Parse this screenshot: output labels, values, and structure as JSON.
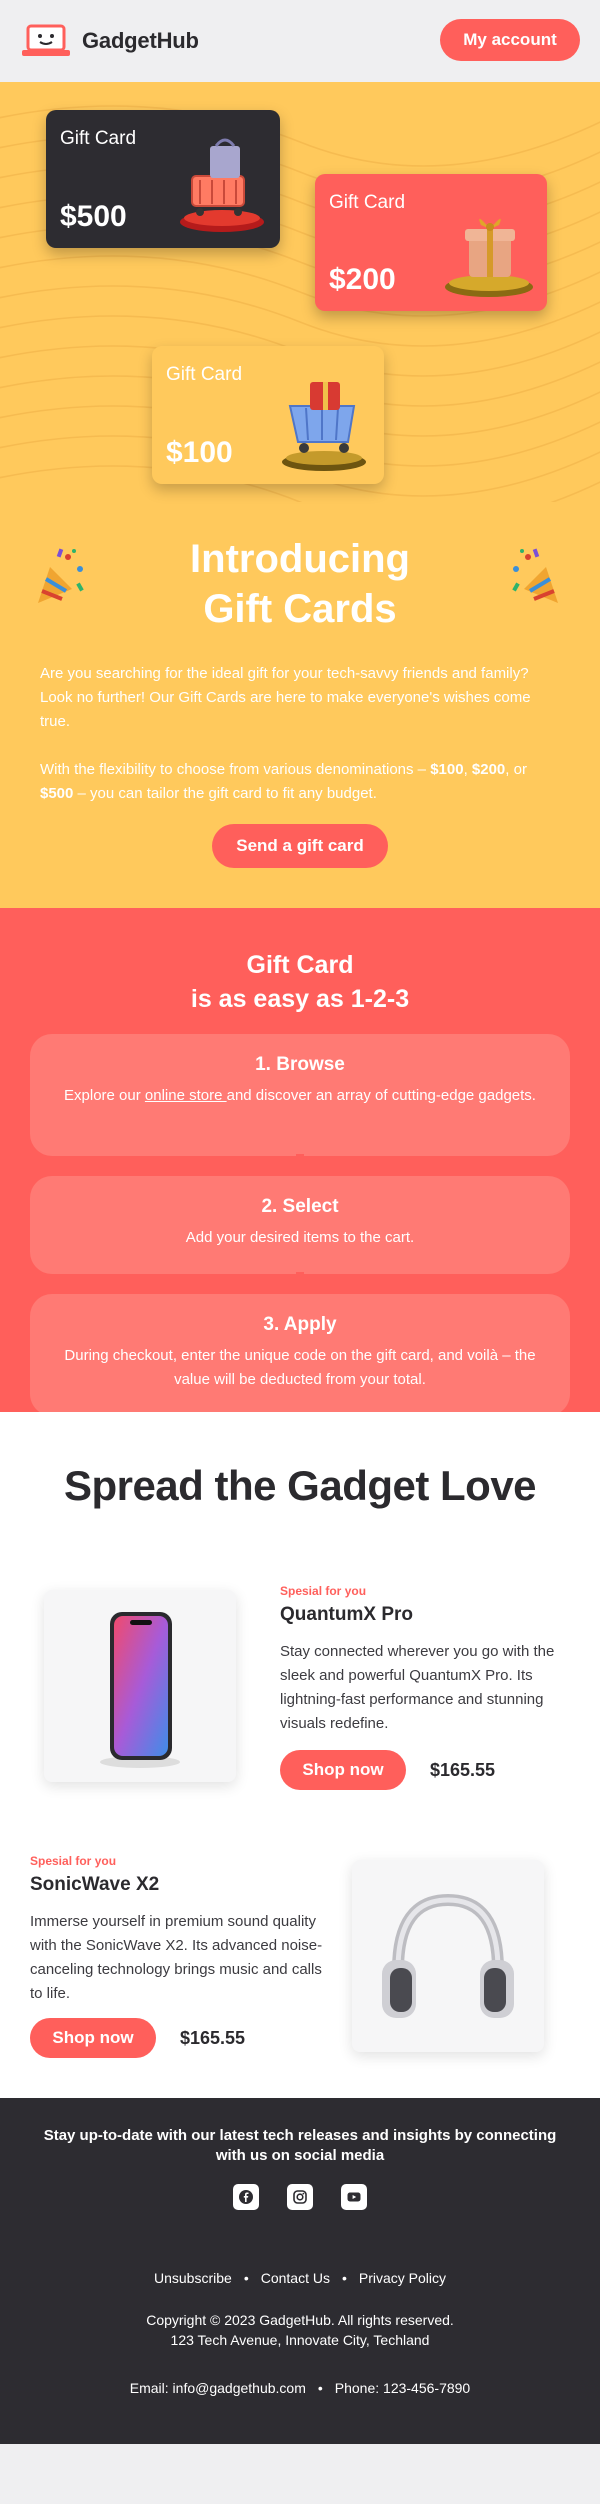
{
  "header": {
    "brand": "GadgetHub",
    "account_label": "My account"
  },
  "hero": {
    "cards": [
      {
        "title": "Gift Card",
        "amount": "$500"
      },
      {
        "title": "Gift Card",
        "amount": "$200"
      },
      {
        "title": "Gift Card",
        "amount": "$100"
      }
    ],
    "title_line1": "Introducing",
    "title_line2": "Gift Cards",
    "paragraph1": "Are you searching for the ideal gift for your tech-savvy friends and family? Look no further! Our Gift Cards are here to make everyone's wishes come true.",
    "paragraph2_prefix": "With the flexibility to choose from various denominations – ",
    "denom1": "$100",
    "denom2": "$200",
    "denom3": "$500",
    "paragraph2_suffix": " – you can tailor the gift card to fit any budget.",
    "cta_label": "Send a gift card"
  },
  "steps": {
    "title_line1": "Gift Card",
    "title_line2": "is as easy as 1-2-3",
    "items": [
      {
        "heading": "1. Browse",
        "before_link": "Explore our ",
        "link": "online store ",
        "after_link": "and discover an array of cutting-edge gadgets."
      },
      {
        "heading": "2. Select",
        "text": "Add your desired items to the cart."
      },
      {
        "heading": "3. Apply",
        "text": "During checkout, enter the unique code on the gift card, and voilà – the value will be deducted from your total."
      }
    ]
  },
  "products": {
    "title": "Spread the Gadget Love",
    "items": [
      {
        "tag": "Spesial for you",
        "name": "QuantumX Pro",
        "description": "Stay connected wherever you go with the sleek and powerful QuantumX Pro. Its lightning-fast performance and stunning visuals redefine.",
        "button": "Shop now",
        "price": "$165.55",
        "image_icon": "smartphone-icon"
      },
      {
        "tag": "Spesial for you",
        "name": "SonicWave X2",
        "description": "Immerse yourself in premium sound quality with the SonicWave X2. Its advanced noise-canceling technology brings music and calls to life.",
        "button": "Shop now",
        "price": "$165.55",
        "image_icon": "headphones-icon"
      }
    ]
  },
  "footer": {
    "headline": "Stay up-to-date with our latest tech releases and insights by connecting with us on social media",
    "social": [
      "facebook-icon",
      "instagram-icon",
      "youtube-icon"
    ],
    "links": [
      "Unsubscribe",
      "Contact Us",
      "Privacy Policy"
    ],
    "copyright": "Copyright © 2023 GadgetHub. All rights reserved.",
    "address": "123 Tech Avenue, Innovate City, Techland",
    "email": "Email: info@gadgethub.com",
    "phone": "Phone: 123-456-7890"
  },
  "colors": {
    "accent": "#ff5f5b",
    "hero_bg": "#ffc95c",
    "dark": "#2d2c31"
  }
}
